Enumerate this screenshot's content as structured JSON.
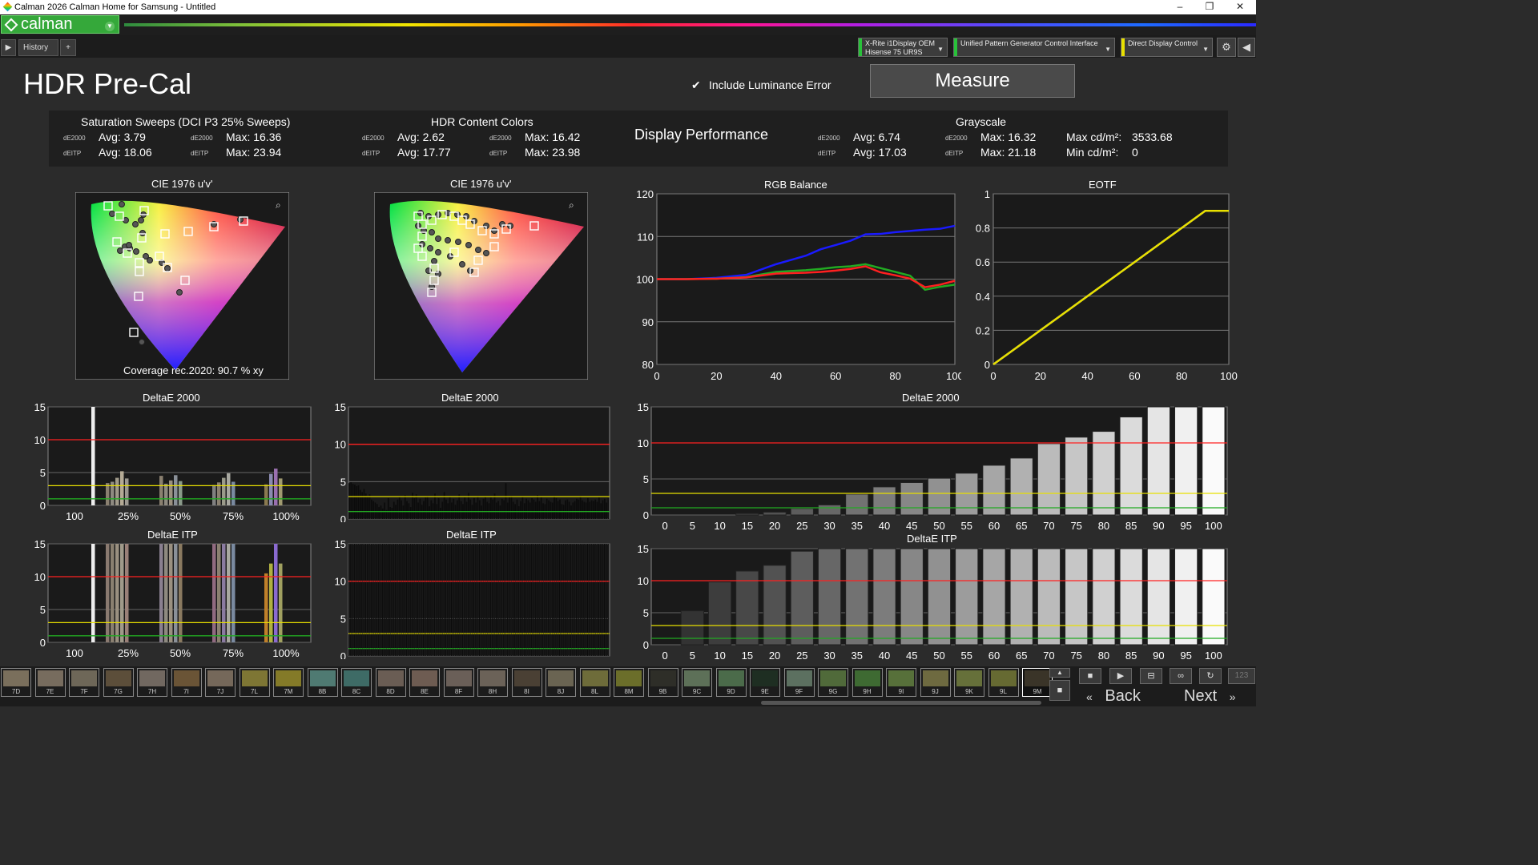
{
  "window": {
    "title": "Calman 2026 Calman Home for Samsung  - Untitled",
    "controls": [
      "–",
      "❐",
      "✕"
    ]
  },
  "logo": {
    "text": "calman"
  },
  "tabs": {
    "history": "History 1",
    "add": "+"
  },
  "devices": [
    {
      "line1": "X-Rite i1Display OEM",
      "line2": "Hisense 75 UR9S",
      "accent": "#29c13a"
    },
    {
      "line1": "Unified Pattern Generator Control Interface",
      "line2": "",
      "accent": "#29c13a"
    },
    {
      "line1": "Direct Display Control",
      "line2": "",
      "accent": "#e8e000"
    }
  ],
  "page": {
    "title": "HDR Pre-Cal",
    "include_luminance": "Include Luminance Error",
    "measure": "Measure"
  },
  "summary": {
    "sat": {
      "title": "Saturation Sweeps (DCI P3 25% Sweeps)",
      "de2000": "dE2000",
      "deitp": "dEITP",
      "avg2000": "Avg: 3.79",
      "max2000": "Max: 16.36",
      "avgitp": "Avg: 18.06",
      "maxitp": "Max: 23.94"
    },
    "hdr": {
      "title": "HDR Content Colors",
      "de2000": "dE2000",
      "deitp": "dEITP",
      "avg2000": "Avg: 2.62",
      "max2000": "Max: 16.42",
      "avgitp": "Avg: 17.77",
      "maxitp": "Max: 23.98"
    },
    "perf": "Display Performance",
    "gray": {
      "title": "Grayscale",
      "de2000": "dE2000",
      "deitp": "dEITP",
      "avg2000": "Avg: 6.74",
      "max2000": "Max: 16.32",
      "avgitp": "Avg: 17.03",
      "maxitp": "Max: 21.18",
      "maxcd_l": "Max cd/m²:",
      "maxcd": "3533.68",
      "mincd_l": "Min cd/m²:",
      "mincd": "0"
    }
  },
  "cie": {
    "title": "CIE 1976 u'v'",
    "coverage": "Coverage rec.2020:  90.7 % xy"
  },
  "rgb_title": "RGB Balance",
  "eotf_title": "EOTF",
  "de2000_title": "DeltaE 2000",
  "deitp_title": "DeltaE ITP",
  "sat_cats": [
    "100",
    "25%",
    "50%",
    "75%",
    "100%"
  ],
  "colors": {
    "red": "#ff2020",
    "yellow": "#e8e000",
    "green": "#22aa22",
    "blue": "#1a1aff"
  },
  "chart_data": [
    {
      "id": "rgb",
      "type": "line",
      "title": "RGB Balance",
      "x": [
        0,
        10,
        20,
        30,
        40,
        45,
        50,
        55,
        60,
        65,
        70,
        75,
        80,
        85,
        90,
        95,
        100
      ],
      "xticks": [
        0,
        20,
        40,
        60,
        80,
        100
      ],
      "yticks": [
        80,
        90,
        100,
        110,
        120
      ],
      "ylim": [
        80,
        120
      ],
      "xlim": [
        0,
        100
      ],
      "series": [
        {
          "color": "#1a1aff",
          "values": [
            100,
            100,
            100.3,
            101,
            103.5,
            104.5,
            105.5,
            107,
            108,
            109,
            110.5,
            110.6,
            111,
            111.3,
            111.6,
            111.8,
            112.5
          ]
        },
        {
          "color": "#22aa22",
          "values": [
            100,
            100,
            100.1,
            100.5,
            101.7,
            101.9,
            102.1,
            102.4,
            102.8,
            103,
            103.5,
            102.6,
            101.7,
            100.8,
            97.5,
            98.2,
            98.7
          ]
        },
        {
          "color": "#ff2020",
          "values": [
            100,
            100,
            100.1,
            100.4,
            101.3,
            101.4,
            101.5,
            101.7,
            102,
            102.4,
            103,
            101.6,
            100.9,
            100.1,
            98.1,
            98.7,
            99.6
          ]
        }
      ]
    },
    {
      "id": "eotf",
      "type": "line",
      "title": "EOTF",
      "x": [
        0,
        10,
        20,
        30,
        40,
        50,
        60,
        70,
        80,
        90,
        95,
        100
      ],
      "xticks": [
        0,
        20,
        40,
        60,
        80,
        100
      ],
      "yticks": [
        0,
        0.2,
        0.4,
        0.6,
        0.8,
        1
      ],
      "ylim": [
        0,
        1
      ],
      "xlim": [
        0,
        100
      ],
      "series": [
        {
          "color": "#aaaaaa",
          "values": [
            0,
            0.1,
            0.2,
            0.3,
            0.4,
            0.5,
            0.6,
            0.7,
            0.8,
            0.9,
            0.9,
            0.9
          ]
        },
        {
          "color": "#e8e000",
          "values": [
            0,
            0.1,
            0.2,
            0.3,
            0.4,
            0.5,
            0.6,
            0.7,
            0.8,
            0.9,
            0.9,
            0.9
          ]
        }
      ]
    },
    {
      "id": "gs2000",
      "type": "bar",
      "title": "DeltaE 2000",
      "categories": [
        "0",
        "5",
        "10",
        "15",
        "20",
        "25",
        "30",
        "35",
        "40",
        "45",
        "50",
        "55",
        "60",
        "65",
        "70",
        "75",
        "80",
        "85",
        "90",
        "95",
        "100"
      ],
      "values": [
        0,
        0,
        0,
        0.2,
        0.4,
        0.9,
        1.4,
        2.9,
        3.9,
        4.5,
        5.1,
        5.8,
        6.9,
        7.9,
        9.9,
        10.8,
        11.6,
        13.6,
        16.3,
        16.3,
        16.3
      ],
      "ylim": [
        0,
        15
      ],
      "yticks": [
        0,
        5,
        10,
        15
      ],
      "thresholds": [
        10,
        3,
        1
      ]
    },
    {
      "id": "gsitp",
      "type": "bar",
      "title": "DeltaE ITP",
      "categories": [
        "0",
        "5",
        "10",
        "15",
        "20",
        "25",
        "30",
        "35",
        "40",
        "45",
        "50",
        "55",
        "60",
        "65",
        "70",
        "75",
        "80",
        "85",
        "90",
        "95",
        "100"
      ],
      "values": [
        0,
        5.3,
        9.8,
        11.5,
        12.4,
        14.6,
        16,
        16,
        16,
        16,
        16,
        16,
        16,
        16,
        16,
        16,
        16,
        16,
        16,
        16,
        16
      ],
      "ylim": [
        0,
        15
      ],
      "yticks": [
        0,
        5,
        10,
        15
      ],
      "thresholds": [
        10,
        3,
        1
      ]
    },
    {
      "id": "sat2000",
      "type": "bar",
      "title": "DeltaE 2000",
      "yticks": [
        0,
        5,
        10,
        15
      ],
      "ylim": [
        0,
        15
      ],
      "thresholds": [
        10,
        3,
        1
      ],
      "values": [
        16,
        3.4,
        3.6,
        4.2,
        5.2,
        4.1,
        4.5,
        3.3,
        3.8,
        4.6,
        3.7,
        3.1,
        3.5,
        4.2,
        4.9,
        3.6,
        3.2,
        4.8,
        5.6,
        4.1
      ],
      "bar_colors": [
        "#eeeeee",
        "#8a8070",
        "#8e8a80",
        "#a09a8a",
        "#b4aa95",
        "#9c9890",
        "#8a8070",
        "#8e8a80",
        "#9a9080",
        "#8a9098",
        "#8a9a8a",
        "#808080",
        "#8a8070",
        "#9a9a8a",
        "#a8a8a0",
        "#7a8aa0",
        "#8a7a50",
        "#8a8ab0",
        "#9a70b0",
        "#a09a70"
      ]
    },
    {
      "id": "satitp",
      "type": "bar",
      "title": "DeltaE ITP",
      "yticks": [
        0,
        5,
        10,
        15
      ],
      "ylim": [
        0,
        15
      ],
      "thresholds": [
        10,
        3,
        1
      ],
      "values": [
        16,
        16,
        16,
        16,
        16,
        16,
        16,
        16,
        16,
        16,
        16,
        16,
        16,
        16,
        16,
        16,
        10.5,
        12,
        16,
        12
      ],
      "bar_colors": [
        "#eeeeee",
        "#8a7a70",
        "#8a8070",
        "#9a9080",
        "#a09a8a",
        "#9a8078",
        "#8a8090",
        "#8e8a80",
        "#9a9080",
        "#8a9098",
        "#8a7a60",
        "#906a80",
        "#8a8070",
        "#8a7aa0",
        "#a8a8a0",
        "#7a8aa0",
        "#c0802a",
        "#b0b040",
        "#8a6ad0",
        "#a0a060"
      ]
    }
  ],
  "hdr_bars_2000": [
    4.8,
    4.9,
    4.7,
    4.6,
    4.4,
    4.5,
    3.9,
    3.6,
    4,
    3.4,
    3.1,
    3.3,
    2.6,
    2.4,
    2.2,
    2,
    1.6,
    1.8,
    1.4,
    2.2,
    1.2,
    2.8,
    1.6,
    1.5,
    2.3,
    1.9,
    2.6,
    3,
    2.5,
    1.8,
    3.2,
    2.4,
    2.1,
    1.6,
    3.5,
    2.8,
    3.3,
    2.2,
    2.7,
    1.9,
    2.4,
    2.9,
    3.1,
    1.7,
    2.5,
    2.1,
    3.4,
    2,
    2.8,
    1.5,
    2.3,
    3.6,
    2.6,
    2.1,
    3,
    2.2,
    2.7,
    1.9,
    2.5,
    3.3,
    2.4,
    2,
    2.9,
    2.3,
    3.5,
    2.6,
    1.9,
    2.8,
    2.2,
    3.1,
    2.5,
    1.8,
    2.7,
    3,
    2.3,
    2.1,
    2.9,
    2.6,
    3.4,
    2.2,
    2.4,
    1.8,
    2.7,
    2.5,
    4.8,
    2.2,
    2.9,
    3.1,
    2.3,
    2,
    2.6,
    1.7,
    2.4,
    3,
    2.1,
    2.7,
    2.5,
    2.2,
    2.8,
    2.6,
    2.3,
    3.2,
    2.4,
    2.9,
    2.1,
    2,
    2.7,
    2.5,
    2.3,
    2.2,
    3.1,
    2.8,
    2.4,
    2.6,
    2,
    1.9,
    2.5,
    2.6,
    2.3,
    1.8,
    2.2,
    2.4,
    2.7,
    2.6,
    3.1,
    2.5,
    2.3,
    2.2,
    2.8,
    2.3,
    2.5,
    2.4,
    2.6,
    2.3,
    2.9,
    2.1,
    2.5,
    2.7,
    2.2,
    2.8
  ],
  "hdr_itp": {
    "ylim": [
      0,
      15
    ],
    "yticks": [
      0,
      5,
      10,
      15
    ]
  },
  "swatches": [
    {
      "label": "7D",
      "color": "#7a6f5c"
    },
    {
      "label": "7E",
      "color": "#776c5e"
    },
    {
      "label": "7F",
      "color": "#6e6758"
    },
    {
      "label": "7G",
      "color": "#5c4e3a"
    },
    {
      "label": "7H",
      "color": "#716860"
    },
    {
      "label": "7I",
      "color": "#6a5436"
    },
    {
      "label": "7J",
      "color": "#75685a"
    },
    {
      "label": "7L",
      "color": "#7e7634"
    },
    {
      "label": "7M",
      "color": "#847a28"
    },
    {
      "label": "8B",
      "color": "#4f7a72"
    },
    {
      "label": "8C",
      "color": "#3e6b66"
    },
    {
      "label": "8D",
      "color": "#6a5d54"
    },
    {
      "label": "8E",
      "color": "#6e5c52"
    },
    {
      "label": "8F",
      "color": "#6a5f58"
    },
    {
      "label": "8H",
      "color": "#6b6258"
    },
    {
      "label": "8I",
      "color": "#4a4034"
    },
    {
      "label": "8J",
      "color": "#6a6452"
    },
    {
      "label": "8L",
      "color": "#6e6c3a"
    },
    {
      "label": "8M",
      "color": "#6b6e2a"
    },
    {
      "label": "9B",
      "color": "#2e2e28"
    },
    {
      "label": "9C",
      "color": "#5d7058"
    },
    {
      "label": "9D",
      "color": "#4b6b4a"
    },
    {
      "label": "9E",
      "color": "#1e2e22"
    },
    {
      "label": "9F",
      "color": "#5c7060"
    },
    {
      "label": "9G",
      "color": "#506a3a"
    },
    {
      "label": "9H",
      "color": "#3e6a32"
    },
    {
      "label": "9I",
      "color": "#57703a"
    },
    {
      "label": "9J",
      "color": "#6e6a40"
    },
    {
      "label": "9K",
      "color": "#66703a"
    },
    {
      "label": "9L",
      "color": "#666a32"
    },
    {
      "label": "9M",
      "color": "#3a3428"
    }
  ],
  "nav": {
    "back": "Back",
    "next": "Next",
    "counter": "123"
  }
}
